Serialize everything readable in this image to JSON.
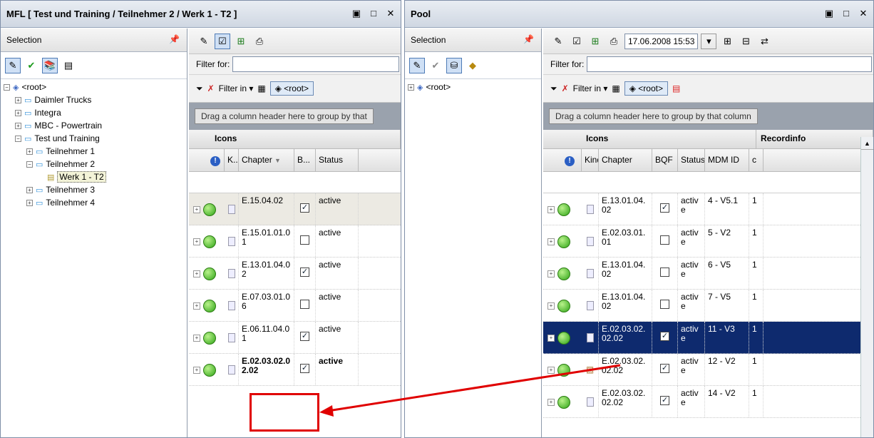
{
  "left": {
    "title": "MFL [ Test und Training / Teilnehmer 2 / Werk 1 - T2 ]",
    "selection_label": "Selection",
    "tree": [
      {
        "label": "<root>",
        "depth": 0,
        "toggle": "⊟",
        "icon": "cube-icon"
      },
      {
        "label": "Daimler Trucks",
        "depth": 1,
        "toggle": "⊞",
        "icon": "folder-icon"
      },
      {
        "label": "Integra",
        "depth": 1,
        "toggle": "⊞",
        "icon": "folder-icon"
      },
      {
        "label": "MBC - Powertrain",
        "depth": 1,
        "toggle": "⊞",
        "icon": "folder-icon"
      },
      {
        "label": "Test und Training",
        "depth": 1,
        "toggle": "⊟",
        "icon": "folder-icon"
      },
      {
        "label": "Teilnehmer 1",
        "depth": 2,
        "toggle": "⊞",
        "icon": "folder-icon"
      },
      {
        "label": "Teilnehmer 2",
        "depth": 2,
        "toggle": "⊟",
        "icon": "folder-icon"
      },
      {
        "label": "Werk 1 - T2",
        "depth": 3,
        "toggle": "",
        "icon": "document-icon",
        "selected": true
      },
      {
        "label": "Teilnehmer 3",
        "depth": 2,
        "toggle": "⊞",
        "icon": "folder-icon"
      },
      {
        "label": "Teilnehmer 4",
        "depth": 2,
        "toggle": "⊞",
        "icon": "folder-icon"
      }
    ],
    "filter_label": "Filter for:",
    "filter_in_label": "Filter in",
    "root_button": "<root>",
    "group_hint": "Drag a column header here to group by that",
    "band_icons": "Icons",
    "columns": [
      "!",
      "K...",
      "Chapter",
      "B...",
      "Status"
    ],
    "sort_indicator": "▼",
    "rows": [
      {
        "chapter": "E.15.04.02",
        "bqf": true,
        "status": "active"
      },
      {
        "chapter": "E.15.01.01.01",
        "bqf": false,
        "status": "active"
      },
      {
        "chapter": "E.13.01.04.02",
        "bqf": true,
        "status": "active"
      },
      {
        "chapter": "E.07.03.01.06",
        "bqf": false,
        "status": "active"
      },
      {
        "chapter": "E.06.11.04.01",
        "bqf": true,
        "status": "active"
      },
      {
        "chapter": "E.02.03.02.02.02",
        "bqf": true,
        "status": "active",
        "new": true
      }
    ]
  },
  "right": {
    "title": "Pool",
    "selection_label": "Selection",
    "tree": [
      {
        "label": "<root>",
        "toggle": "⊞",
        "icon": "cube-icon"
      }
    ],
    "date_value": "17.06.2008 15:53",
    "filter_label": "Filter for:",
    "filter_in_label": "Filter in",
    "root_button": "<root>",
    "group_hint": "Drag a column header here to group by that column",
    "band_icons": "Icons",
    "band_recordinfo": "Recordinfo",
    "columns": [
      "!",
      "Kind",
      "Chapter",
      "BQF",
      "Status",
      "MDM ID",
      "c"
    ],
    "rows": [
      {
        "chapter": "E.13.01.04.02",
        "bqf": true,
        "status": "active",
        "mdm": "4 - V5.1",
        "c": "1"
      },
      {
        "chapter": "E.02.03.01.01",
        "bqf": false,
        "status": "active",
        "mdm": "5 - V2",
        "c": "1"
      },
      {
        "chapter": "E.13.01.04.02",
        "bqf": false,
        "status": "active",
        "mdm": "6 - V5",
        "c": "1"
      },
      {
        "chapter": "E.13.01.04.02",
        "bqf": false,
        "status": "active",
        "mdm": "7 - V5",
        "c": "1"
      },
      {
        "chapter": "E.02.03.02.02.02",
        "bqf": true,
        "status": "active",
        "mdm": "11 - V3",
        "c": "1",
        "selected": true
      },
      {
        "chapter": "E.02.03.02.02.02",
        "bqf": true,
        "status": "active",
        "mdm": "12 - V2",
        "c": "1",
        "kind": "box-icon"
      },
      {
        "chapter": "E.02.03.02.02.02",
        "bqf": true,
        "status": "active",
        "mdm": "14 - V2",
        "c": "1"
      }
    ]
  },
  "colors": {
    "highlight_row": "#0e2a6e",
    "annotation_red": "#e00000",
    "status_green": "#2fa417"
  }
}
